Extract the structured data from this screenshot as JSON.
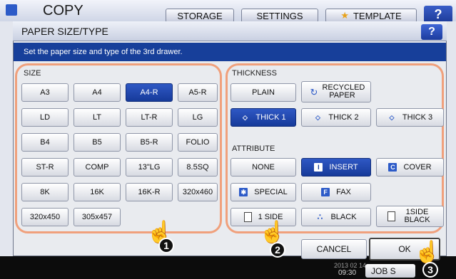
{
  "background": {
    "title": "COPY",
    "tabs": [
      "STORAGE",
      "SETTINGS",
      "TEMPLATE"
    ],
    "help": "?",
    "date": "2013 02 14",
    "time": "09:30",
    "job_status": "JOB S"
  },
  "dialog": {
    "title": "PAPER SIZE/TYPE",
    "help": "?",
    "instruction": "Set the paper size and type of the 3rd drawer.",
    "size_label": "SIZE",
    "sizes": [
      "A3",
      "A4",
      "A4-R",
      "A5-R",
      "LD",
      "LT",
      "LT-R",
      "LG",
      "B4",
      "B5",
      "B5-R",
      "FOLIO",
      "ST-R",
      "COMP",
      "13\"LG",
      "8.5SQ",
      "8K",
      "16K",
      "16K-R",
      "320x460",
      "320x450",
      "305x457"
    ],
    "selected_size": "A4-R",
    "thickness_label": "THICKNESS",
    "thickness": {
      "plain": "PLAIN",
      "recycled": "RECYCLED PAPER",
      "thick1": "THICK 1",
      "thick2": "THICK 2",
      "thick3": "THICK 3",
      "selected": "THICK 1"
    },
    "attribute_label": "ATTRIBUTE",
    "attributes": {
      "none": "NONE",
      "insert": "INSERT",
      "cover": "COVER",
      "special": "SPECIAL",
      "fax": "FAX",
      "one_side": "1 SIDE",
      "black": "BLACK",
      "one_side_black": "1SIDE BLACK",
      "selected": "INSERT"
    },
    "cancel": "CANCEL",
    "ok": "OK"
  },
  "callouts": [
    "1",
    "2",
    "3"
  ],
  "colors": {
    "accent": "#173f9a",
    "highlight_ring": "#f0a07c",
    "button_face": "#ffffff"
  }
}
